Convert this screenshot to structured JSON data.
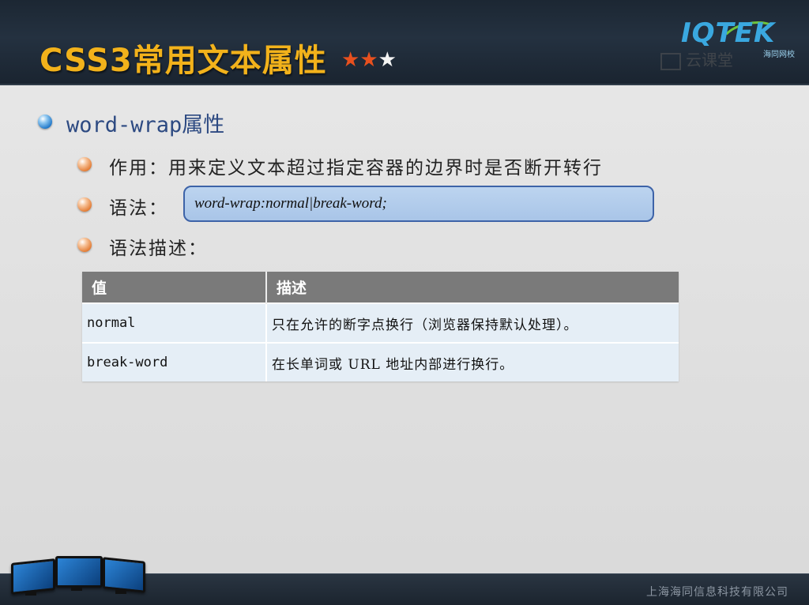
{
  "header": {
    "title": "CSS3常用文本属性",
    "stars_filled": 2,
    "stars_total": 3,
    "logo_text": "IQTEK",
    "logo_subtitle": "海同网校",
    "watermark": "云课堂"
  },
  "section": {
    "heading": "word-wrap属性",
    "purpose": "作用：用来定义文本超过指定容器的边界时是否断开转行",
    "syntax_label": "语法：",
    "syntax_code": "word-wrap:normal|break-word;",
    "description_label": "语法描述："
  },
  "table": {
    "columns": [
      "值",
      "描述"
    ],
    "rows": [
      {
        "value": "normal",
        "description": "只在允许的断字点换行（浏览器保持默认处理）。"
      },
      {
        "value": "break-word",
        "description": "在长单词或 URL 地址内部进行换行。"
      }
    ]
  },
  "footer": {
    "company": "上海海同信息科技有限公司"
  },
  "colors": {
    "title": "#f2b21b",
    "heading": "#2d4a82",
    "star_filled": "#e8501e",
    "star_empty": "#f4f4f4",
    "table_header": "#7a7a7a",
    "table_cell": "#e5eef6",
    "syntax_box": "#a9c5e8"
  }
}
